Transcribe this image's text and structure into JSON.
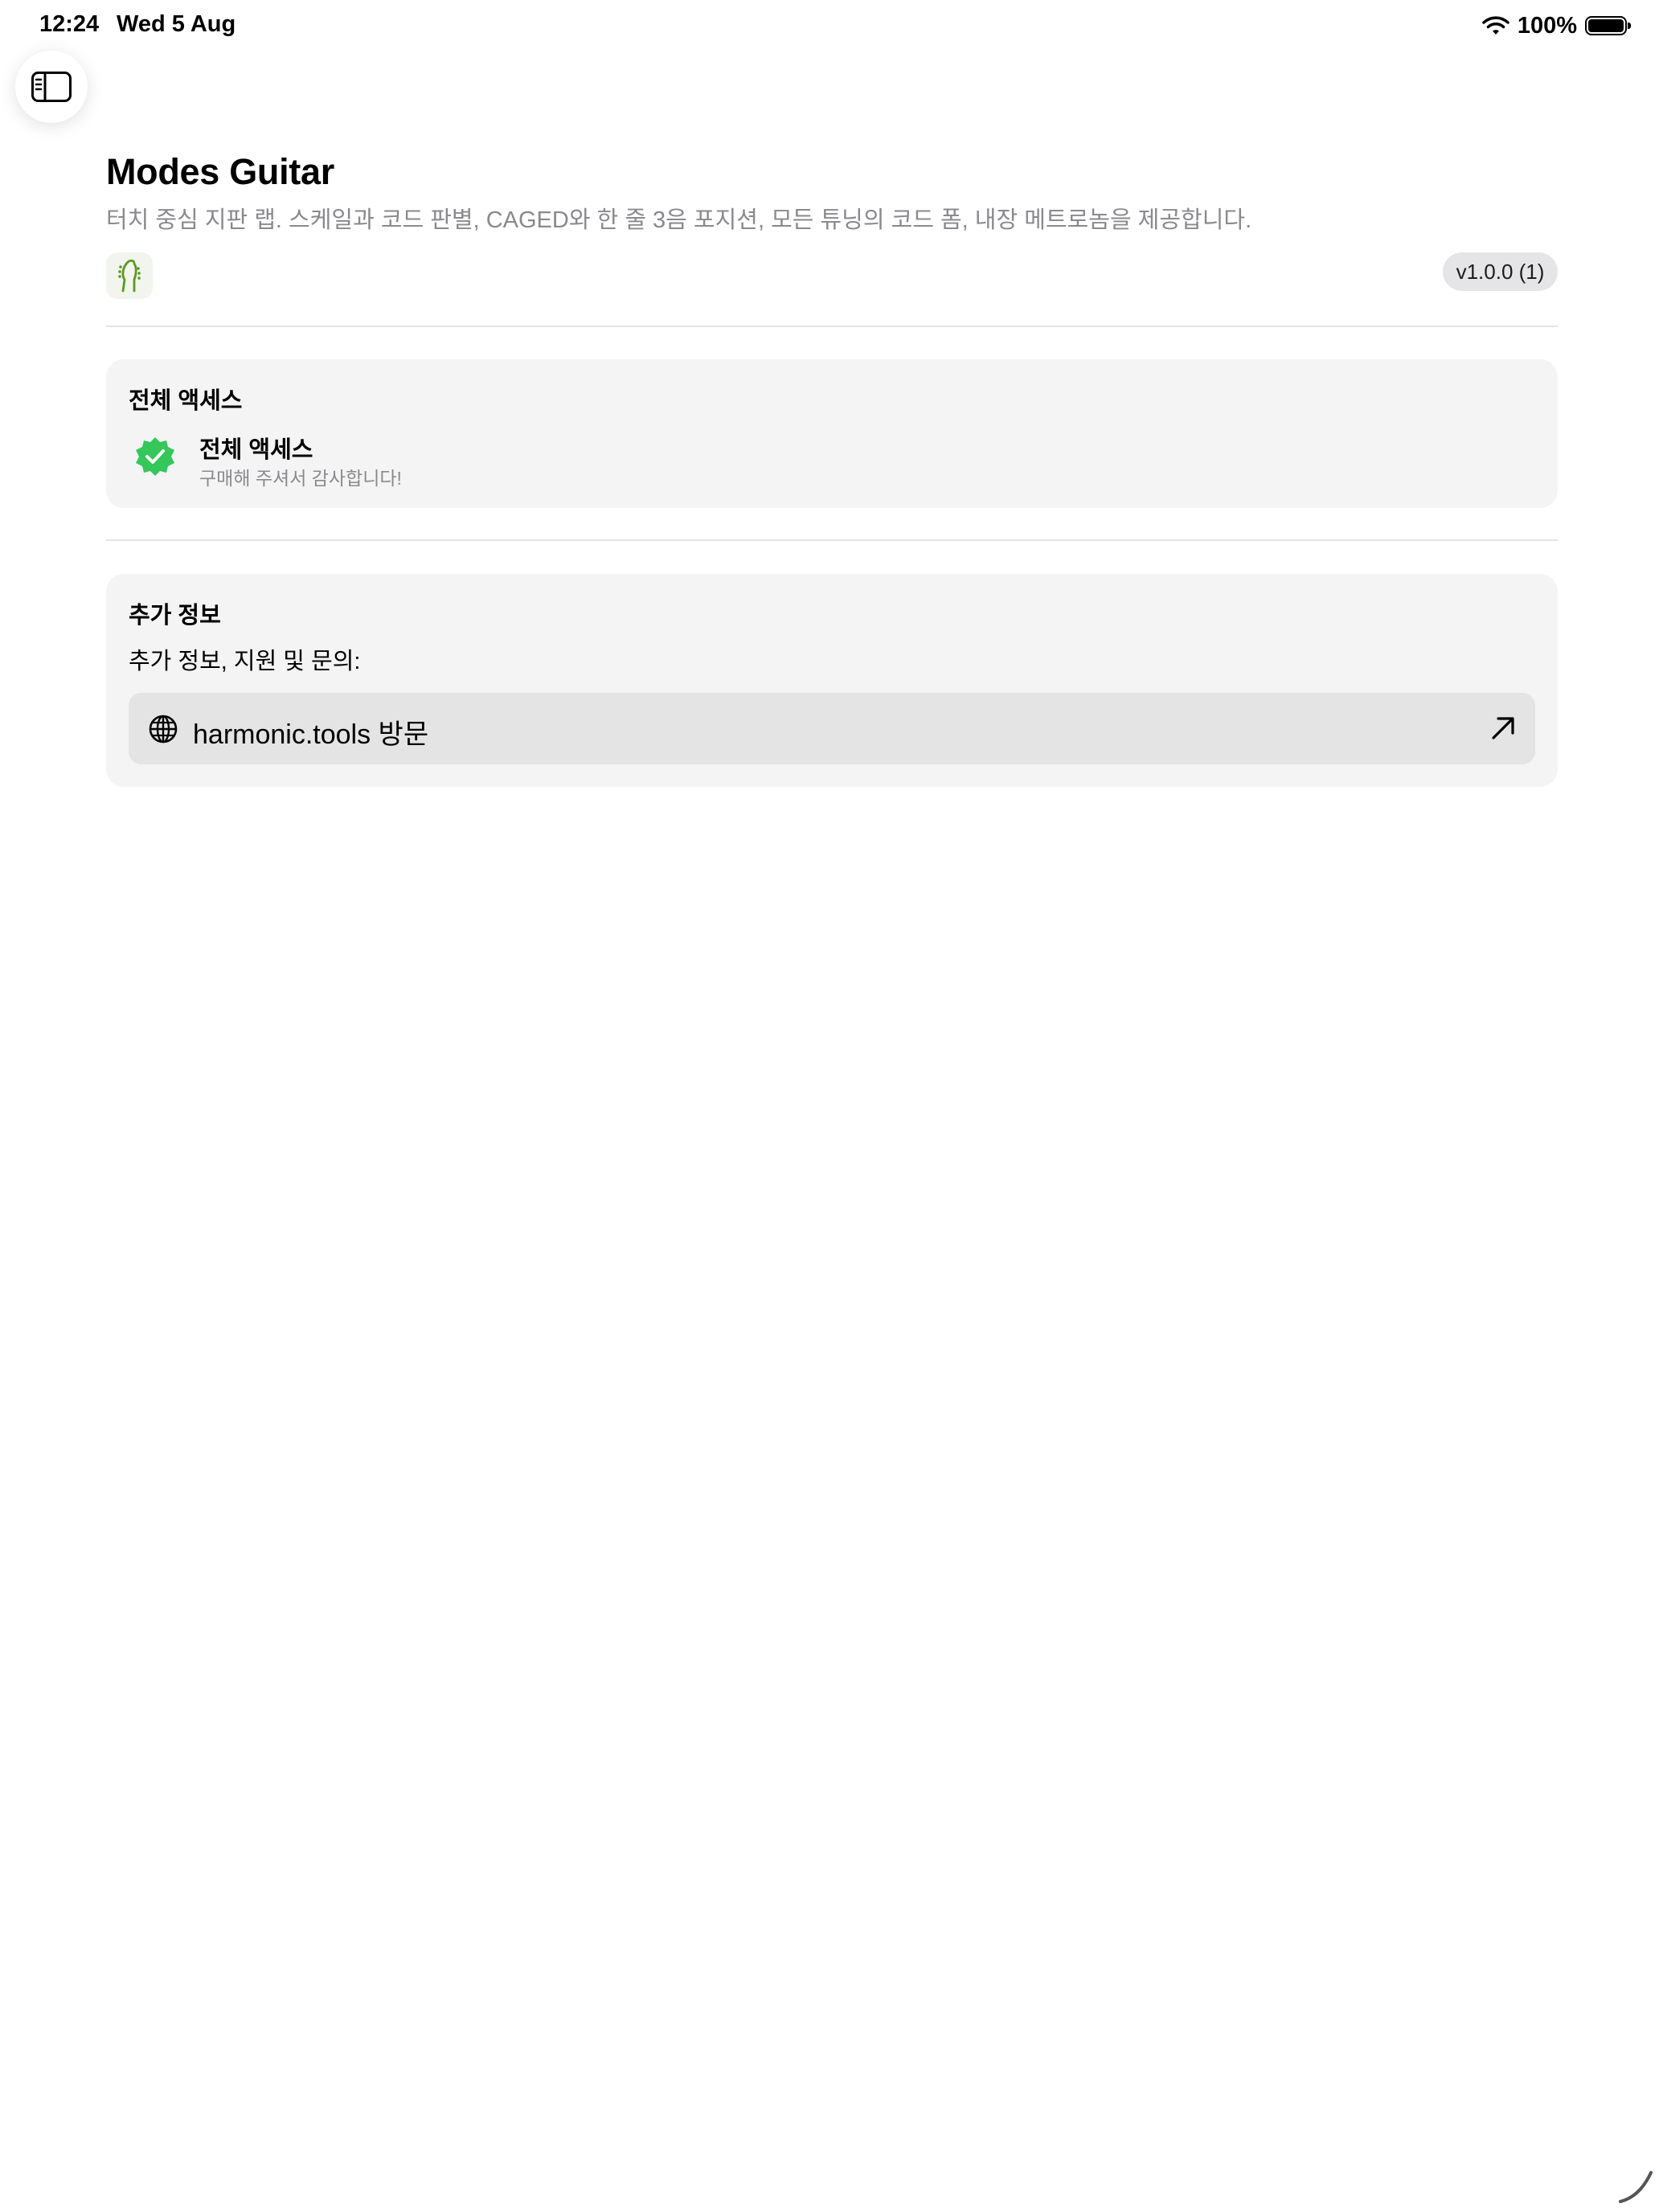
{
  "status_bar": {
    "time": "12:24",
    "date": "Wed 5 Aug",
    "battery": "100%"
  },
  "header": {
    "title": "Modes Guitar",
    "subtitle": "터치 중심 지판 랩. 스케일과 코드 판별, CAGED와 한 줄 3음 포지션, 모든 튜닝의 코드 폼, 내장 메트로놈을 제공합니다.",
    "version": "v1.0.0 (1)"
  },
  "access_section": {
    "section_title": "전체 액세스",
    "item_title": "전체 액세스",
    "item_subtitle": "구매해 주셔서 감사합니다!"
  },
  "info_section": {
    "section_title": "추가 정보",
    "description": "추가 정보, 지원 및 문의:",
    "link_label": "harmonic.tools 방문"
  },
  "colors": {
    "accent_green": "#34c759",
    "app_icon_green": "#5a9a1e",
    "card_background": "#f4f4f4",
    "secondary_text": "#8a8a8e"
  },
  "icons": {
    "sidebar_toggle": "sidebar-left-icon",
    "wifi": "wifi-icon",
    "battery": "battery-icon",
    "app": "guitar-headstock-icon",
    "verified": "checkmark-seal-icon",
    "globe": "globe-icon",
    "external": "arrow-up-right-icon"
  }
}
